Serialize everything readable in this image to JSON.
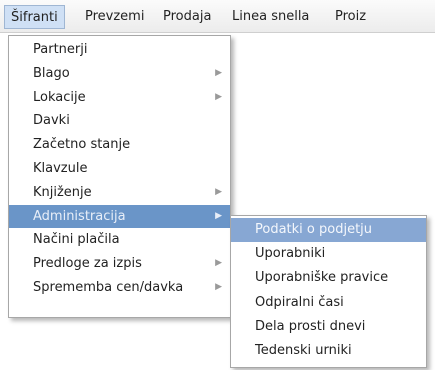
{
  "menubar": {
    "items": [
      {
        "label": "Šifranti"
      },
      {
        "label": "Prevzemi"
      },
      {
        "label": "Prodaja"
      },
      {
        "label": "Linea snella"
      },
      {
        "label": "Proiz"
      }
    ]
  },
  "main_menu": {
    "items": [
      {
        "label": "Partnerji"
      },
      {
        "label": "Blago"
      },
      {
        "label": "Lokacije"
      },
      {
        "label": "Davki"
      },
      {
        "label": "Začetno stanje"
      },
      {
        "label": "Klavzule"
      },
      {
        "label": "Knjiženje"
      },
      {
        "label": "Administracija"
      },
      {
        "label": "Načini plačila"
      },
      {
        "label": "Predloge za izpis"
      },
      {
        "label": "Sprememba cen/davka"
      }
    ]
  },
  "submenu": {
    "items": [
      {
        "label": "Podatki o podjetju"
      },
      {
        "label": "Uporabniki"
      },
      {
        "label": "Uporabniške pravice"
      },
      {
        "label": "Odpiralni časi"
      },
      {
        "label": "Dela prosti dnevi"
      },
      {
        "label": "Tedenski urniki"
      }
    ]
  },
  "colors": {
    "highlight": "#6a95c8",
    "submenu_highlight": "#87a7d3",
    "menubar_active": "#cfe0f5"
  },
  "icons": {
    "submenu_arrow": "chevron-right-icon"
  }
}
